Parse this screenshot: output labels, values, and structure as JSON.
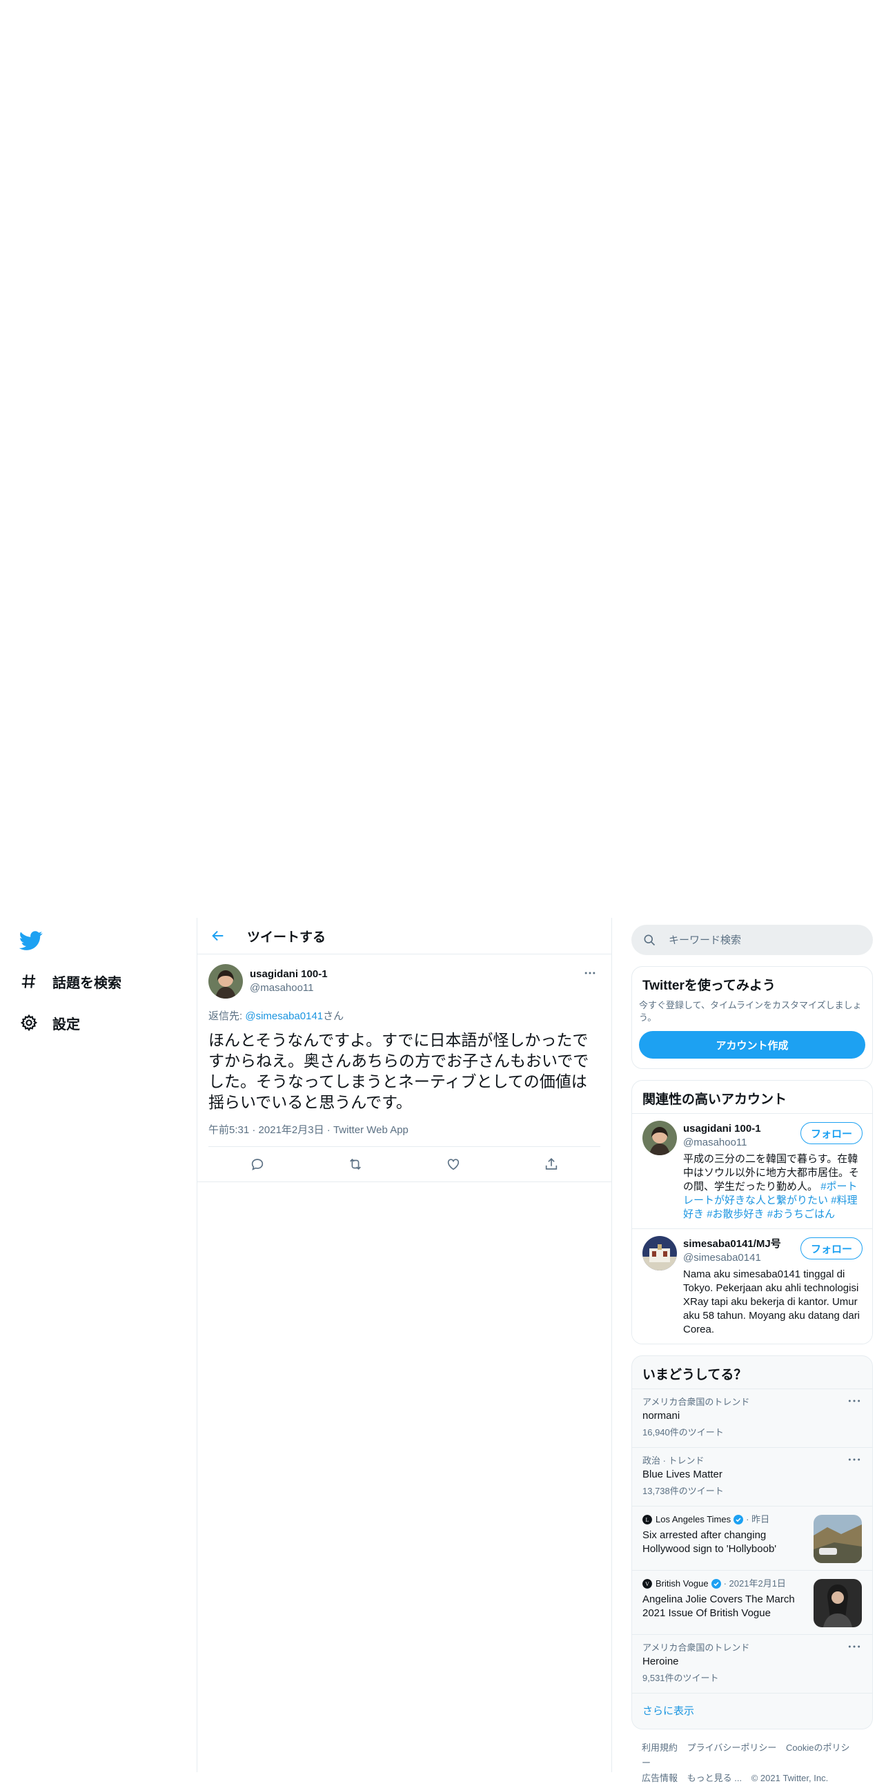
{
  "nav": {
    "items": [
      {
        "label": "話題を検索",
        "icon": "hashtag-icon"
      },
      {
        "label": "設定",
        "icon": "gear-icon"
      }
    ]
  },
  "main": {
    "title": "ツイートする"
  },
  "tweet": {
    "display_name": "usagidani 100-1",
    "handle": "@masahoo11",
    "reply_prefix": "返信先: ",
    "reply_to": "@simesaba0141",
    "reply_suffix": "さん",
    "text": "ほんとそうなんですよ。すでに日本語が怪しかったですからねえ。奥さんあちらの方でお子さんもおいででした。そうなってしまうとネーティブとしての価値は揺らいでいると思うんです。",
    "time": "午前5:31",
    "date": "2021年2月3日",
    "source": "Twitter Web App",
    "separator": "·"
  },
  "search": {
    "placeholder": "キーワード検索"
  },
  "signup": {
    "title": "Twitterを使ってみよう",
    "desc": "今すぐ登録して、タイムラインをカスタマイズしましょう。",
    "button": "アカウント作成"
  },
  "relevant": {
    "title": "関連性の高いアカウント",
    "follow_label": "フォロー",
    "accounts": [
      {
        "name": "usagidani 100-1",
        "handle": "@masahoo11",
        "bio": "平成の三分の二を韓国で暮らす。在韓中はソウル以外に地方大都市居住。その間、学生だったり勤め人。",
        "tags": [
          "#ポートレートが好きな人と繋がりたい",
          "#料理好き",
          "#お散歩好き",
          "#おうちごはん"
        ]
      },
      {
        "name": "simesaba0141/MJ号",
        "handle": "@simesaba0141",
        "bio": "Nama aku simesaba0141 tinggal di Tokyo. Pekerjaan aku ahli technologisi XRay tapi aku bekerja di kantor. Umur aku 58 tahun. Moyang aku datang dari Corea.",
        "tags": []
      }
    ]
  },
  "trends": {
    "title": "いまどうしてる？",
    "items": [
      {
        "kind": "trend",
        "context": "アメリカ合衆国のトレンド",
        "name": "normani",
        "count": "16,940件のツイート"
      },
      {
        "kind": "trend",
        "context": "政治 · トレンド",
        "name": "Blue Lives Matter",
        "count": "13,738件のツイート"
      },
      {
        "kind": "news",
        "source": "Los Angeles Times",
        "when": "· 昨日",
        "headline": "Six arrested after changing Hollywood sign to 'Hollyboob'"
      },
      {
        "kind": "news",
        "source": "British Vogue",
        "when": "· 2021年2月1日",
        "headline": "Angelina Jolie Covers The March 2021 Issue Of British Vogue"
      },
      {
        "kind": "trend",
        "context": "アメリカ合衆国のトレンド",
        "name": "Heroine",
        "count": "9,531件のツイート"
      }
    ],
    "more": "さらに表示"
  },
  "footer": {
    "links": [
      "利用規約",
      "プライバシーポリシー",
      "Cookieのポリシー",
      "広告情報",
      "もっと見る ..."
    ],
    "copyright": "© 2021 Twitter, Inc."
  },
  "colors": {
    "accent": "#1da1f2",
    "link": "#1b95e0",
    "muted": "#5b7083",
    "border": "#e6ecf0"
  }
}
